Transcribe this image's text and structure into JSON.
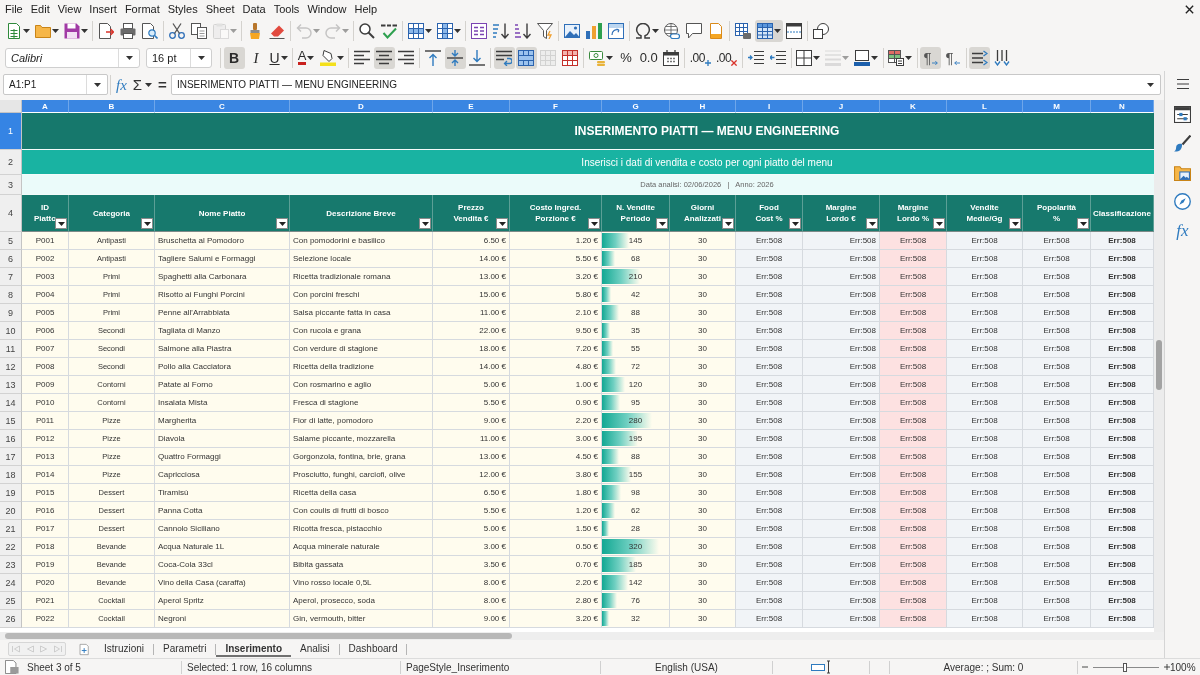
{
  "menu_bar": [
    "File",
    "Edit",
    "View",
    "Insert",
    "Format",
    "Styles",
    "Sheet",
    "Data",
    "Tools",
    "Window",
    "Help"
  ],
  "standard_toolbar": [
    [
      {
        "kind": "new",
        "on": false,
        "disabled": false
      },
      {
        "kind": "open",
        "on": false,
        "disabled": false
      },
      {
        "kind": "save",
        "on": false,
        "disabled": false
      }
    ],
    [
      {
        "kind": "export",
        "on": false,
        "disabled": false
      },
      {
        "kind": "print",
        "on": false,
        "disabled": false
      },
      {
        "kind": "preview",
        "on": false,
        "disabled": false
      }
    ],
    [
      {
        "kind": "cut",
        "on": false,
        "disabled": false
      },
      {
        "kind": "copy",
        "on": false,
        "disabled": false
      },
      {
        "kind": "paste",
        "on": false,
        "disabled": true
      }
    ],
    [
      {
        "kind": "clone",
        "on": false,
        "disabled": false
      },
      {
        "kind": "clear",
        "on": false,
        "disabled": false
      }
    ],
    [
      {
        "kind": "undo",
        "on": false,
        "disabled": true
      },
      {
        "kind": "redo",
        "on": false,
        "disabled": true
      }
    ],
    [
      {
        "kind": "find",
        "on": false,
        "disabled": false
      },
      {
        "kind": "spelling",
        "on": false,
        "disabled": false
      }
    ],
    [
      {
        "kind": "rows",
        "on": false,
        "disabled": false
      },
      {
        "kind": "columns",
        "on": false,
        "disabled": false
      }
    ],
    [
      {
        "kind": "sort",
        "on": false,
        "disabled": false
      },
      {
        "kind": "ascending",
        "on": false,
        "disabled": false
      },
      {
        "kind": "descending",
        "on": false,
        "disabled": false
      },
      {
        "kind": "autofilter",
        "on": false,
        "disabled": false
      }
    ],
    [
      {
        "kind": "image",
        "on": false,
        "disabled": false
      },
      {
        "kind": "chart",
        "on": false,
        "disabled": false
      },
      {
        "kind": "pivot",
        "on": false,
        "disabled": false
      }
    ],
    [
      {
        "kind": "symbol",
        "on": false,
        "disabled": false
      },
      {
        "kind": "hyperlink",
        "on": false,
        "disabled": false
      },
      {
        "kind": "comment",
        "on": false,
        "disabled": false
      },
      {
        "kind": "headers",
        "on": false,
        "disabled": false
      }
    ],
    [
      {
        "kind": "printarea",
        "on": false,
        "disabled": false
      },
      {
        "kind": "freeze",
        "on": true,
        "disabled": false
      },
      {
        "kind": "split",
        "on": false,
        "disabled": false
      }
    ],
    [
      {
        "kind": "shapes",
        "on": false,
        "disabled": false
      }
    ]
  ],
  "formatting_toolbar": {
    "font_name": "Calibri",
    "font_size": "16 pt",
    "groups": [
      [
        {
          "kind": "bold",
          "glyph": "B",
          "on": true,
          "disabled": false
        },
        {
          "kind": "italic",
          "glyph": "I",
          "on": false,
          "disabled": false
        },
        {
          "kind": "underline",
          "glyph": "U",
          "on": false,
          "disabled": false
        }
      ],
      [
        {
          "kind": "fontcolor",
          "glyph": "A",
          "on": false,
          "disabled": false
        },
        {
          "kind": "highlight",
          "on": false,
          "disabled": false
        }
      ],
      [
        {
          "kind": "left",
          "on": false,
          "disabled": false
        },
        {
          "kind": "center",
          "on": true,
          "disabled": false
        },
        {
          "kind": "right",
          "on": false,
          "disabled": false
        }
      ],
      [
        {
          "kind": "top",
          "on": false,
          "disabled": false
        },
        {
          "kind": "middle",
          "on": true,
          "disabled": false
        },
        {
          "kind": "bottom",
          "on": false,
          "disabled": false
        }
      ],
      [
        {
          "kind": "wrap",
          "on": true,
          "disabled": false
        },
        {
          "kind": "mergecenter",
          "on": true,
          "disabled": false
        },
        {
          "kind": "merge",
          "on": false,
          "disabled": true
        },
        {
          "kind": "unmerge",
          "on": false,
          "disabled": false
        }
      ],
      [
        {
          "kind": "currency",
          "on": false,
          "disabled": false
        },
        {
          "kind": "percent",
          "glyph": "%",
          "on": false,
          "disabled": false
        },
        {
          "kind": "standard",
          "glyph": "0.0",
          "on": false,
          "disabled": false
        },
        {
          "kind": "date",
          "on": false,
          "disabled": false
        }
      ],
      [
        {
          "kind": "adddecimal",
          "glyph": ".00",
          "on": false,
          "disabled": false
        },
        {
          "kind": "deldecimal",
          "glyph": ".00",
          "on": false,
          "disabled": false
        }
      ],
      [
        {
          "kind": "indent",
          "on": false,
          "disabled": false
        },
        {
          "kind": "outdent",
          "on": false,
          "disabled": false
        }
      ],
      [
        {
          "kind": "borders",
          "on": false,
          "disabled": false
        },
        {
          "kind": "borderstyle",
          "on": false,
          "disabled": true
        },
        {
          "kind": "bordercolor",
          "on": false,
          "disabled": false
        }
      ],
      [
        {
          "kind": "conditional",
          "on": false,
          "disabled": false
        }
      ],
      [
        {
          "kind": "ltr",
          "glyph": "¶",
          "on": true,
          "disabled": false
        },
        {
          "kind": "rtl",
          "glyph": "¶",
          "on": false,
          "disabled": false
        }
      ],
      [
        {
          "kind": "horizontal",
          "on": true,
          "disabled": false
        },
        {
          "kind": "vertical",
          "on": false,
          "disabled": false
        }
      ]
    ]
  },
  "formula_bar": {
    "name_box": "A1:P1",
    "wizard": "fx",
    "sum": "Σ",
    "equals": "=",
    "content": "INSERIMENTO PIATTI — MENU ENGINEERING"
  },
  "sidebar": [
    {
      "kind": "properties"
    },
    {
      "kind": "styles"
    },
    {
      "kind": "gallery"
    },
    {
      "kind": "navigator"
    },
    {
      "kind": "functions",
      "glyph": "fx"
    }
  ],
  "sheet": {
    "columns": [
      {
        "letter": "A",
        "selected": true,
        "heading": "ID\nPiatto",
        "filter": true,
        "kind": "code"
      },
      {
        "letter": "B",
        "selected": true,
        "heading": "Categoria",
        "filter": true,
        "kind": "category"
      },
      {
        "letter": "C",
        "selected": true,
        "heading": "Nome Piatto",
        "filter": true,
        "kind": "name"
      },
      {
        "letter": "D",
        "selected": true,
        "heading": "Descrizione Breve",
        "filter": true,
        "kind": "note"
      },
      {
        "letter": "E",
        "selected": true,
        "heading": "Prezzo\nVendita €",
        "filter": true,
        "kind": "money"
      },
      {
        "letter": "F",
        "selected": true,
        "heading": "Costo Ingred.\nPorzione €",
        "filter": true,
        "kind": "money"
      },
      {
        "letter": "G",
        "selected": true,
        "heading": "N. Vendite\nPeriodo",
        "filter": true,
        "kind": "bar"
      },
      {
        "letter": "H",
        "selected": true,
        "heading": "Giorni\nAnalizzati",
        "filter": true,
        "kind": "count"
      },
      {
        "letter": "I",
        "selected": true,
        "heading": "Food\nCost %",
        "filter": true,
        "kind": "formula"
      },
      {
        "letter": "J",
        "selected": true,
        "heading": "Margine\nLordo €",
        "filter": true,
        "kind": "amount"
      },
      {
        "letter": "K",
        "selected": true,
        "heading": "Margine\nLordo %",
        "filter": true,
        "kind": "alert"
      },
      {
        "letter": "L",
        "selected": true,
        "heading": "Vendite\nMedie/Gg",
        "filter": true,
        "kind": "formula"
      },
      {
        "letter": "M",
        "selected": true,
        "heading": "Popolarità\n%",
        "filter": true,
        "kind": "formula"
      },
      {
        "letter": "N",
        "selected": true,
        "heading": "Classificazione",
        "filter": false,
        "kind": "result"
      }
    ],
    "banner_rows": [
      {
        "number": "1",
        "selected": true,
        "kind": "title",
        "text": "INSERIMENTO PIATTI — MENU ENGINEERING"
      },
      {
        "number": "2",
        "selected": false,
        "kind": "subtitle",
        "text": "Inserisci i dati di vendita e costo per ogni piatto del menu"
      },
      {
        "number": "3",
        "selected": false,
        "kind": "info",
        "text": "Data analisi: 02/06/2026   |   Anno: 2026"
      }
    ],
    "heading_row": {
      "number": "4",
      "selected": false
    },
    "rows": [
      {
        "number": "5",
        "selected": false,
        "level": 0.4,
        "cells": [
          "P001",
          "Antipasti",
          "Bruschetta al Pomodoro",
          "Con pomodorini e basilico",
          "6.50 €",
          "1.20 €",
          "145",
          "30",
          "Err:508",
          "Err:508",
          "Err:508",
          "Err:508",
          "Err:508",
          "Err:508"
        ]
      },
      {
        "number": "6",
        "selected": false,
        "level": 0.2,
        "cells": [
          "P002",
          "Antipasti",
          "Tagliere Salumi e Formaggi",
          "Selezione locale",
          "14.00 €",
          "5.50 €",
          "68",
          "30",
          "Err:508",
          "Err:508",
          "Err:508",
          "Err:508",
          "Err:508",
          "Err:508"
        ]
      },
      {
        "number": "7",
        "selected": false,
        "level": 0.57,
        "cells": [
          "P003",
          "Primi",
          "Spaghetti alla Carbonara",
          "Ricetta tradizionale romana",
          "13.00 €",
          "3.20 €",
          "210",
          "30",
          "Err:508",
          "Err:508",
          "Err:508",
          "Err:508",
          "Err:508",
          "Err:508"
        ]
      },
      {
        "number": "8",
        "selected": false,
        "level": 0.14,
        "cells": [
          "P004",
          "Primi",
          "Risotto ai Funghi Porcini",
          "Con porcini freschi",
          "15.00 €",
          "5.80 €",
          "42",
          "30",
          "Err:508",
          "Err:508",
          "Err:508",
          "Err:508",
          "Err:508",
          "Err:508"
        ]
      },
      {
        "number": "9",
        "selected": false,
        "level": 0.25,
        "cells": [
          "P005",
          "Primi",
          "Penne all'Arrabbiata",
          "Salsa piccante fatta in casa",
          "11.00 €",
          "2.10 €",
          "88",
          "30",
          "Err:508",
          "Err:508",
          "Err:508",
          "Err:508",
          "Err:508",
          "Err:508"
        ]
      },
      {
        "number": "10",
        "selected": false,
        "level": 0.12,
        "cells": [
          "P006",
          "Secondi",
          "Tagliata di Manzo",
          "Con rucola e grana",
          "22.00 €",
          "9.50 €",
          "35",
          "30",
          "Err:508",
          "Err:508",
          "Err:508",
          "Err:508",
          "Err:508",
          "Err:508"
        ]
      },
      {
        "number": "11",
        "selected": false,
        "level": 0.17,
        "cells": [
          "P007",
          "Secondi",
          "Salmone alla Piastra",
          "Con verdure di stagione",
          "18.00 €",
          "7.20 €",
          "55",
          "30",
          "Err:508",
          "Err:508",
          "Err:508",
          "Err:508",
          "Err:508",
          "Err:508"
        ]
      },
      {
        "number": "12",
        "selected": false,
        "level": 0.21,
        "cells": [
          "P008",
          "Secondi",
          "Pollo alla Cacciatora",
          "Ricetta della tradizione",
          "14.00 €",
          "4.80 €",
          "72",
          "30",
          "Err:508",
          "Err:508",
          "Err:508",
          "Err:508",
          "Err:508",
          "Err:508"
        ]
      },
      {
        "number": "13",
        "selected": false,
        "level": 0.34,
        "cells": [
          "P009",
          "Contorni",
          "Patate al Forno",
          "Con rosmarino e aglio",
          "5.00 €",
          "1.00 €",
          "120",
          "30",
          "Err:508",
          "Err:508",
          "Err:508",
          "Err:508",
          "Err:508",
          "Err:508"
        ]
      },
      {
        "number": "14",
        "selected": false,
        "level": 0.27,
        "cells": [
          "P010",
          "Contorni",
          "Insalata Mista",
          "Fresca di stagione",
          "5.50 €",
          "0.90 €",
          "95",
          "30",
          "Err:508",
          "Err:508",
          "Err:508",
          "Err:508",
          "Err:508",
          "Err:508"
        ]
      },
      {
        "number": "15",
        "selected": false,
        "level": 0.75,
        "cells": [
          "P011",
          "Pizze",
          "Margherita",
          "Fior di latte, pomodoro",
          "9.00 €",
          "2.20 €",
          "280",
          "30",
          "Err:508",
          "Err:508",
          "Err:508",
          "Err:508",
          "Err:508",
          "Err:508"
        ]
      },
      {
        "number": "16",
        "selected": false,
        "level": 0.53,
        "cells": [
          "P012",
          "Pizze",
          "Diavola",
          "Salame piccante, mozzarella",
          "11.00 €",
          "3.00 €",
          "195",
          "30",
          "Err:508",
          "Err:508",
          "Err:508",
          "Err:508",
          "Err:508",
          "Err:508"
        ]
      },
      {
        "number": "17",
        "selected": false,
        "level": 0.25,
        "cells": [
          "P013",
          "Pizze",
          "Quattro Formaggi",
          "Gorgonzola, fontina, brie, grana",
          "13.00 €",
          "4.50 €",
          "88",
          "30",
          "Err:508",
          "Err:508",
          "Err:508",
          "Err:508",
          "Err:508",
          "Err:508"
        ]
      },
      {
        "number": "18",
        "selected": false,
        "level": 0.43,
        "cells": [
          "P014",
          "Pizze",
          "Capricciosa",
          "Prosciutto, funghi, carciofi, olive",
          "12.00 €",
          "3.80 €",
          "155",
          "30",
          "Err:508",
          "Err:508",
          "Err:508",
          "Err:508",
          "Err:508",
          "Err:508"
        ]
      },
      {
        "number": "19",
        "selected": false,
        "level": 0.28,
        "cells": [
          "P015",
          "Dessert",
          "Tiramisù",
          "Ricetta della casa",
          "6.50 €",
          "1.80 €",
          "98",
          "30",
          "Err:508",
          "Err:508",
          "Err:508",
          "Err:508",
          "Err:508",
          "Err:508"
        ]
      },
      {
        "number": "20",
        "selected": false,
        "level": 0.19,
        "cells": [
          "P016",
          "Dessert",
          "Panna Cotta",
          "Con coulis di frutti di bosco",
          "5.50 €",
          "1.20 €",
          "62",
          "30",
          "Err:508",
          "Err:508",
          "Err:508",
          "Err:508",
          "Err:508",
          "Err:508"
        ]
      },
      {
        "number": "21",
        "selected": false,
        "level": 0.1,
        "cells": [
          "P017",
          "Dessert",
          "Cannolo Siciliano",
          "Ricotta fresca, pistacchio",
          "5.00 €",
          "1.50 €",
          "28",
          "30",
          "Err:508",
          "Err:508",
          "Err:508",
          "Err:508",
          "Err:508",
          "Err:508"
        ]
      },
      {
        "number": "22",
        "selected": false,
        "level": 0.85,
        "cells": [
          "P018",
          "Bevande",
          "Acqua Naturale 1L",
          "Acqua minerale naturale",
          "3.00 €",
          "0.50 €",
          "320",
          "30",
          "Err:508",
          "Err:508",
          "Err:508",
          "Err:508",
          "Err:508",
          "Err:508"
        ]
      },
      {
        "number": "23",
        "selected": false,
        "level": 0.5,
        "cells": [
          "P019",
          "Bevande",
          "Coca-Cola 33cl",
          "Bibita gassata",
          "3.50 €",
          "0.70 €",
          "185",
          "30",
          "Err:508",
          "Err:508",
          "Err:508",
          "Err:508",
          "Err:508",
          "Err:508"
        ]
      },
      {
        "number": "24",
        "selected": false,
        "level": 0.39,
        "cells": [
          "P020",
          "Bevande",
          "Vino della Casa (caraffa)",
          "Vino rosso locale 0,5L",
          "8.00 €",
          "2.20 €",
          "142",
          "30",
          "Err:508",
          "Err:508",
          "Err:508",
          "Err:508",
          "Err:508",
          "Err:508"
        ]
      },
      {
        "number": "25",
        "selected": false,
        "level": 0.22,
        "cells": [
          "P021",
          "Cocktail",
          "Aperol Spritz",
          "Aperol, prosecco, soda",
          "8.00 €",
          "2.80 €",
          "76",
          "30",
          "Err:508",
          "Err:508",
          "Err:508",
          "Err:508",
          "Err:508",
          "Err:508"
        ]
      },
      {
        "number": "26",
        "selected": false,
        "level": 0.11,
        "cells": [
          "P022",
          "Cocktail",
          "Negroni",
          "Gin, vermouth, bitter",
          "9.00 €",
          "3.20 €",
          "32",
          "30",
          "Err:508",
          "Err:508",
          "Err:508",
          "Err:508",
          "Err:508",
          "Err:508"
        ]
      }
    ]
  },
  "sheet_tabs": [
    {
      "label": "Istruzioni",
      "selected": false
    },
    {
      "label": "Parametri",
      "selected": false
    },
    {
      "label": "Inserimento",
      "selected": true
    },
    {
      "label": "Analisi",
      "selected": false
    },
    {
      "label": "Dashboard",
      "selected": false
    }
  ],
  "status_bar": {
    "sheet": "Sheet 3 of 5",
    "selection": "Selected: 1 row, 16 columns",
    "page_style": "PageStyle_Inserimento",
    "language": "English (USA)",
    "summary": "Average: ; Sum: 0",
    "zoom": {
      "level": 0.48,
      "label": "100%"
    }
  }
}
